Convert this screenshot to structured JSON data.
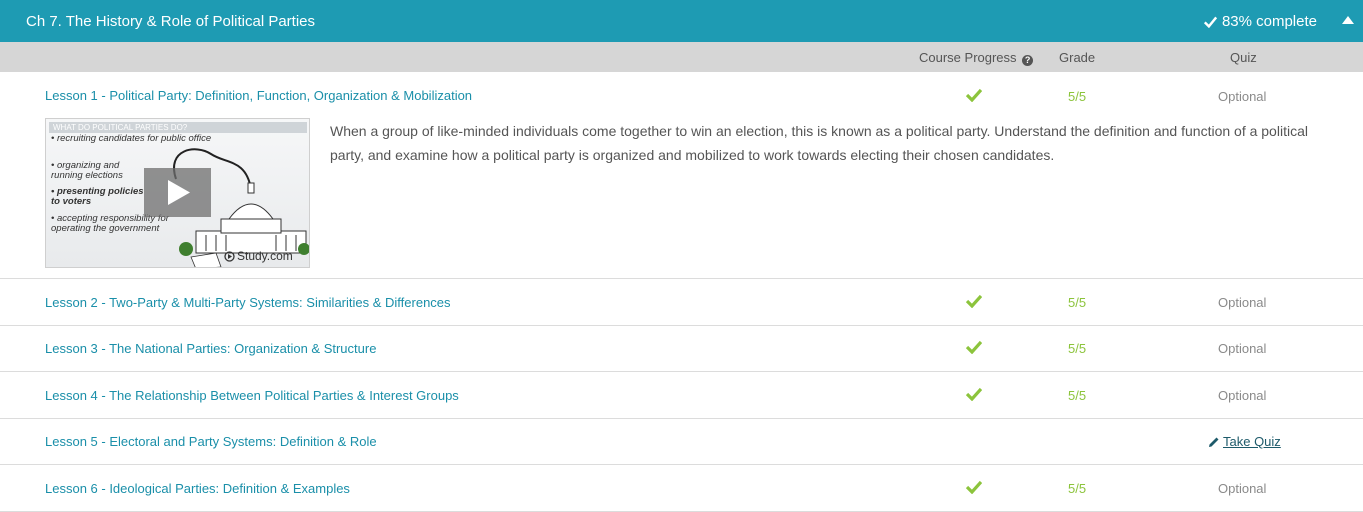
{
  "chapter": {
    "title": "Ch 7. The History & Role of Political Parties",
    "progress_label": "83% complete"
  },
  "columns": {
    "course_progress": "Course Progress",
    "grade": "Grade",
    "quiz": "Quiz"
  },
  "lessons": [
    {
      "title": "Lesson 1 - Political Party: Definition, Function, Organization & Mobilization",
      "completed": true,
      "grade": "5/5",
      "quiz": "Optional"
    },
    {
      "title": "Lesson 2 - Two-Party & Multi-Party Systems: Similarities & Differences",
      "completed": true,
      "grade": "5/5",
      "quiz": "Optional"
    },
    {
      "title": "Lesson 3 - The National Parties: Organization & Structure",
      "completed": true,
      "grade": "5/5",
      "quiz": "Optional"
    },
    {
      "title": "Lesson 4 - The Relationship Between Political Parties & Interest Groups",
      "completed": true,
      "grade": "5/5",
      "quiz": "Optional"
    },
    {
      "title": "Lesson 5 - Electoral and Party Systems: Definition & Role",
      "completed": false,
      "grade": "",
      "quiz": "Take Quiz"
    },
    {
      "title": "Lesson 6 - Ideological Parties: Definition & Examples",
      "completed": true,
      "grade": "5/5",
      "quiz": "Optional"
    }
  ],
  "lesson1_description": "When a group of like-minded individuals come together to win an election, this is known as a political party. Understand the definition and function of a political party, and examine how a political party is organized and mobilized to work towards electing their chosen candidates.",
  "thumbnail": {
    "banner": "WHAT DO POLITICAL PARTIES DO?",
    "items": [
      "• recruiting candidates for public office",
      "• organizing and running elections",
      "• presenting policies to voters",
      "• accepting responsibility for operating the government"
    ],
    "logo": "Study.com"
  },
  "colors": {
    "header_bg": "#1e9bb3",
    "link": "#1a8fa9",
    "check": "#8cc43c",
    "column_header_bg": "#d6d6d6"
  }
}
